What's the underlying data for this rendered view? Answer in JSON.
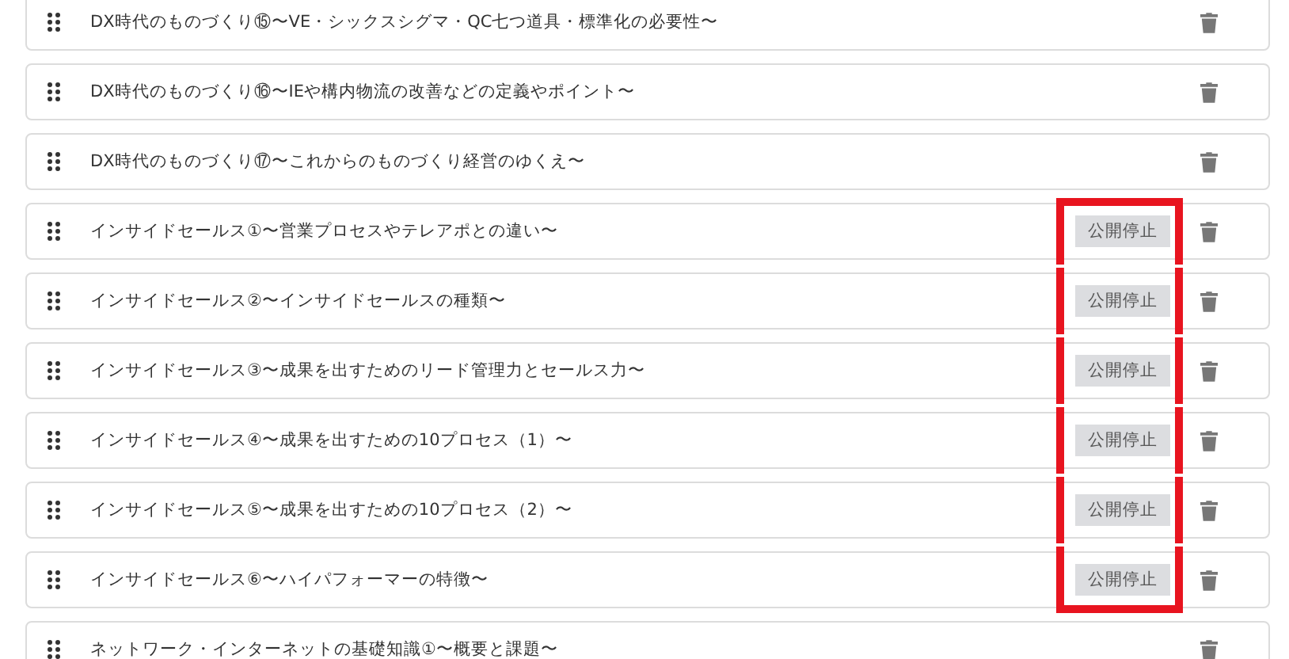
{
  "items": [
    {
      "title": "DX時代のものづくり⑮〜VE・シックスシグマ・QC七つ道具・標準化の必要性〜",
      "highlighted": false
    },
    {
      "title": "DX時代のものづくり⑯〜IEや構内物流の改善などの定義やポイント〜",
      "highlighted": false
    },
    {
      "title": "DX時代のものづくり⑰〜これからのものづくり経営のゆくえ〜",
      "highlighted": false
    },
    {
      "title": "インサイドセールス①〜営業プロセスやテレアポとの違い〜",
      "badge": "公開停止",
      "highlighted": true
    },
    {
      "title": "インサイドセールス②〜インサイドセールスの種類〜",
      "badge": "公開停止",
      "highlighted": true
    },
    {
      "title": "インサイドセールス③〜成果を出すためのリード管理力とセールス力〜",
      "badge": "公開停止",
      "highlighted": true
    },
    {
      "title": "インサイドセールス④〜成果を出すための10プロセス（1）〜",
      "badge": "公開停止",
      "highlighted": true
    },
    {
      "title": "インサイドセールス⑤〜成果を出すための10プロセス（2）〜",
      "badge": "公開停止",
      "highlighted": true
    },
    {
      "title": "インサイドセールス⑥〜ハイパフォーマーの特徴〜",
      "badge": "公開停止",
      "highlighted": true
    },
    {
      "title": "ネットワーク・インターネットの基礎知識①〜概要と課題〜",
      "highlighted": false
    }
  ]
}
